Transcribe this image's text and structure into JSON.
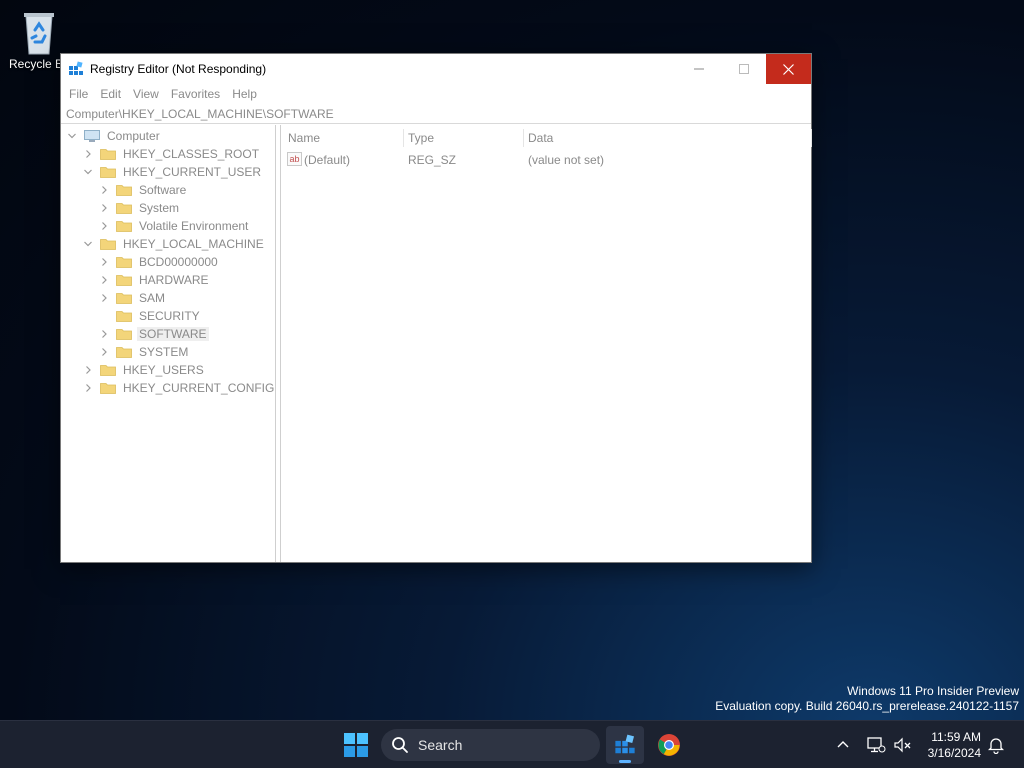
{
  "desktop": {
    "recycle_bin_label": "Recycle B"
  },
  "watermark": {
    "line1": "Windows 11 Pro Insider Preview",
    "line2": "Evaluation copy. Build 26040.rs_prerelease.240122-1157"
  },
  "window": {
    "title": "Registry Editor (Not Responding)",
    "menu": [
      "File",
      "Edit",
      "View",
      "Favorites",
      "Help"
    ],
    "address": "Computer\\HKEY_LOCAL_MACHINE\\SOFTWARE"
  },
  "tree": [
    {
      "label": "Computer",
      "level": 0,
      "expander": "open",
      "icon": "computer-icon"
    },
    {
      "label": "HKEY_CLASSES_ROOT",
      "level": 1,
      "expander": "closed",
      "icon": "folder-icon"
    },
    {
      "label": "HKEY_CURRENT_USER",
      "level": 1,
      "expander": "open",
      "icon": "folder-icon"
    },
    {
      "label": "Software",
      "level": 2,
      "expander": "closed",
      "icon": "folder-icon"
    },
    {
      "label": "System",
      "level": 2,
      "expander": "closed",
      "icon": "folder-icon"
    },
    {
      "label": "Volatile Environment",
      "level": 2,
      "expander": "closed",
      "icon": "folder-icon"
    },
    {
      "label": "HKEY_LOCAL_MACHINE",
      "level": 1,
      "expander": "open",
      "icon": "folder-icon"
    },
    {
      "label": "BCD00000000",
      "level": 2,
      "expander": "closed",
      "icon": "folder-icon"
    },
    {
      "label": "HARDWARE",
      "level": 2,
      "expander": "closed",
      "icon": "folder-icon"
    },
    {
      "label": "SAM",
      "level": 2,
      "expander": "closed",
      "icon": "folder-icon"
    },
    {
      "label": "SECURITY",
      "level": 2,
      "expander": "none",
      "icon": "folder-icon"
    },
    {
      "label": "SOFTWARE",
      "level": 2,
      "expander": "closed",
      "icon": "folder-icon",
      "selected": true
    },
    {
      "label": "SYSTEM",
      "level": 2,
      "expander": "closed",
      "icon": "folder-icon"
    },
    {
      "label": "HKEY_USERS",
      "level": 1,
      "expander": "closed",
      "icon": "folder-icon"
    },
    {
      "label": "HKEY_CURRENT_CONFIG",
      "level": 1,
      "expander": "closed",
      "icon": "folder-icon"
    }
  ],
  "list": {
    "columns": [
      "Name",
      "Type",
      "Data"
    ],
    "rows": [
      {
        "name": "(Default)",
        "type": "REG_SZ",
        "data": "(value not set)",
        "icon": "string-value-icon"
      }
    ]
  },
  "taskbar": {
    "search_label": "Search",
    "time": "11:59 AM",
    "date": "3/16/2024"
  },
  "colors": {
    "close_button": "#c42b1c",
    "taskbar": "#1c2230",
    "folder": "#f3d57a",
    "active_indicator": "#5eb3ff"
  }
}
